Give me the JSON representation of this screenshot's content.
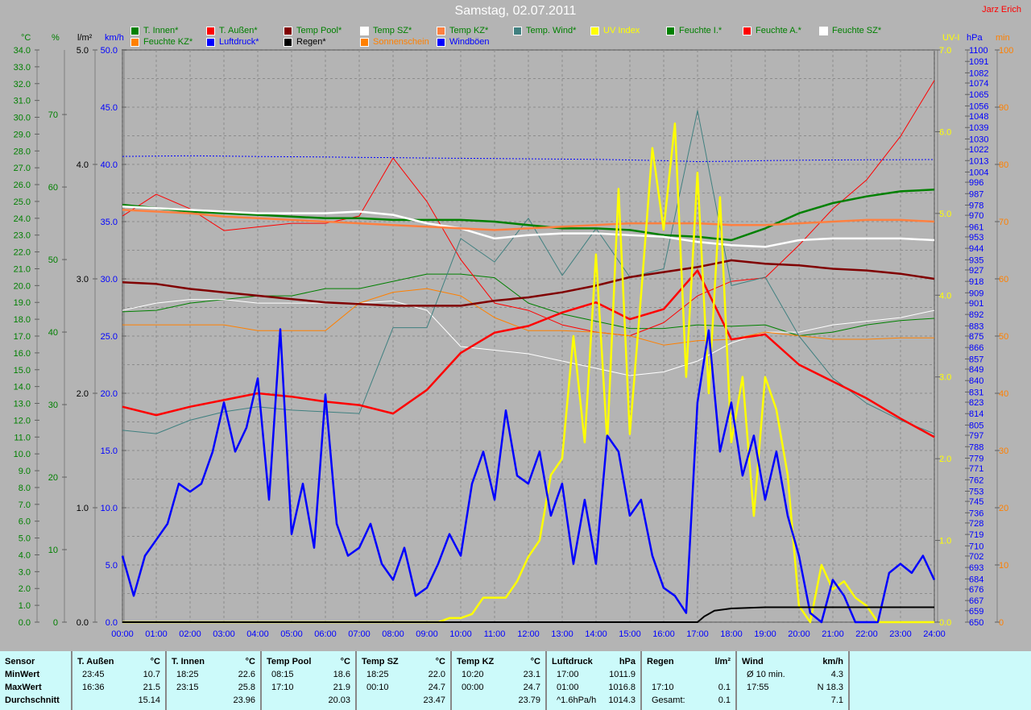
{
  "header": {
    "title": "Samstag, 02.07.2011",
    "author": "Jarz Erich"
  },
  "legend": [
    {
      "label": "T. Innen*",
      "color": "#008000",
      "text": "#008000"
    },
    {
      "label": "T. Außen*",
      "color": "#ff0000",
      "text": "#008000"
    },
    {
      "label": "Temp Pool*",
      "color": "#800000",
      "text": "#008000"
    },
    {
      "label": "Temp SZ*",
      "color": "#ffffff",
      "text": "#008000"
    },
    {
      "label": "Temp KZ*",
      "color": "#ff8040",
      "text": "#008000"
    },
    {
      "label": "Temp. Wind*",
      "color": "#408080",
      "text": "#008000"
    },
    {
      "label": "UV Index",
      "color": "#ffff00",
      "text": "#ffff00"
    },
    {
      "label": "Feuchte I.*",
      "color": "#008000",
      "text": "#008000"
    },
    {
      "label": "Feuchte A.*",
      "color": "#ff0000",
      "text": "#008000"
    },
    {
      "label": "Feuchte SZ*",
      "color": "#ffffff",
      "text": "#008000"
    },
    {
      "label": "Feuchte KZ*",
      "color": "#ff8000",
      "text": "#008000"
    },
    {
      "label": "Luftdruck*",
      "color": "#0000ff",
      "text": "#0000ff"
    },
    {
      "label": "Regen*",
      "color": "#000000",
      "text": "#000000"
    },
    {
      "label": "Sonnenschein",
      "color": "#ff8000",
      "text": "#ff8000"
    },
    {
      "label": "Windböen",
      "color": "#0000ff",
      "text": "#0000ff"
    }
  ],
  "chart_data": {
    "type": "line",
    "title": "Samstag, 02.07.2011",
    "xlabel": "",
    "x_ticks": [
      "00:00",
      "01:00",
      "02:00",
      "03:00",
      "04:00",
      "05:00",
      "06:00",
      "07:00",
      "08:00",
      "09:00",
      "10:00",
      "11:00",
      "12:00",
      "13:00",
      "14:00",
      "15:00",
      "16:00",
      "17:00",
      "18:00",
      "19:00",
      "20:00",
      "21:00",
      "22:00",
      "23:00",
      "24:00"
    ],
    "xlim": [
      0,
      24
    ],
    "grid": true,
    "axes": {
      "degC": {
        "unit": "°C",
        "color": "#008000",
        "range": [
          0,
          34
        ],
        "ticks": [
          "0.0",
          "1.0",
          "2.0",
          "3.0",
          "4.0",
          "5.0",
          "6.0",
          "7.0",
          "8.0",
          "9.0",
          "10.0",
          "11.0",
          "12.0",
          "13.0",
          "14.0",
          "15.0",
          "16.0",
          "17.0",
          "18.0",
          "19.0",
          "20.0",
          "21.0",
          "22.0",
          "23.0",
          "24.0",
          "25.0",
          "26.0",
          "27.0",
          "28.0",
          "29.0",
          "30.0",
          "31.0",
          "32.0",
          "33.0",
          "34.0"
        ]
      },
      "pct": {
        "unit": "%",
        "color": "#008000",
        "range": [
          0,
          78.9
        ],
        "ticks": [
          "0",
          "10",
          "20",
          "30",
          "40",
          "50",
          "60",
          "70"
        ]
      },
      "rain": {
        "unit": "l/m²",
        "color": "#000000",
        "range": [
          0,
          5
        ],
        "ticks": [
          "0.0",
          "1.0",
          "2.0",
          "3.0",
          "4.0",
          "5.0"
        ]
      },
      "kmh": {
        "unit": "km/h",
        "color": "#0000ff",
        "range": [
          0,
          50
        ],
        "ticks": [
          "0.0",
          "5.0",
          "10.0",
          "15.0",
          "20.0",
          "25.0",
          "30.0",
          "35.0",
          "40.0",
          "45.0",
          "50.0"
        ]
      },
      "uv": {
        "unit": "UV-I",
        "color": "#ffff00",
        "range": [
          0,
          7
        ],
        "ticks": [
          "0.0",
          "1.0",
          "2.0",
          "3.0",
          "4.0",
          "5.0",
          "6.0",
          "7.0"
        ]
      },
      "hpa": {
        "unit": "hPa",
        "color": "#0000ff",
        "range": [
          650,
          1100
        ],
        "ticks": [
          "650",
          "659",
          "667",
          "676",
          "684",
          "693",
          "702",
          "710",
          "719",
          "728",
          "736",
          "745",
          "753",
          "762",
          "771",
          "779",
          "788",
          "797",
          "805",
          "814",
          "823",
          "831",
          "840",
          "849",
          "857",
          "866",
          "875",
          "883",
          "892",
          "901",
          "909",
          "918",
          "927",
          "935",
          "944",
          "953",
          "961",
          "970",
          "978",
          "987",
          "996",
          "1004",
          "1013",
          "1022",
          "1030",
          "1039",
          "1048",
          "1056",
          "1065",
          "1074",
          "1082",
          "1091",
          "1100"
        ]
      },
      "min": {
        "unit": "min",
        "color": "#ff8000",
        "range": [
          0,
          100
        ],
        "ticks": [
          "0",
          "10",
          "20",
          "30",
          "40",
          "50",
          "60",
          "70",
          "80",
          "90",
          "100"
        ]
      }
    },
    "series": [
      {
        "name": "Feuchte I.*",
        "axis": "pct",
        "color": "#008000",
        "width": 1,
        "step": 1,
        "values": [
          42.8,
          43,
          44,
          44.5,
          45,
          45,
          46,
          46,
          47,
          48,
          48,
          47.5,
          44,
          42.5,
          41.5,
          40.5,
          40.5,
          41,
          40.8,
          41,
          39.5,
          40,
          41,
          41.6,
          41.9
        ]
      },
      {
        "name": "Feuchte A.*",
        "axis": "pct",
        "color": "#ff0000",
        "width": 1,
        "step": 1,
        "values": [
          56,
          59,
          57,
          54,
          54.5,
          55,
          55,
          56,
          64,
          58,
          50,
          44,
          43,
          41,
          40,
          39.5,
          41.3,
          45,
          47,
          47.5,
          52,
          57,
          61,
          67,
          74.7
        ]
      },
      {
        "name": "Feuchte SZ*",
        "axis": "pct",
        "color": "#ffffff",
        "width": 1,
        "step": 1,
        "values": [
          43,
          44,
          44.5,
          44.5,
          44,
          44,
          44,
          44,
          44.3,
          43,
          38,
          37.5,
          37,
          36,
          35,
          34,
          34.5,
          36,
          38.5,
          40,
          40,
          41,
          41.5,
          42,
          43
        ]
      },
      {
        "name": "Feuchte KZ*",
        "axis": "pct",
        "color": "#ff8000",
        "width": 1,
        "step": 1,
        "values": [
          41,
          41,
          41,
          41,
          40.2,
          40.2,
          40.2,
          44,
          45.5,
          46,
          45,
          42,
          40.2,
          40.2,
          40,
          39.5,
          38.2,
          38.8,
          39,
          40,
          39.5,
          39,
          39,
          39.2,
          39.2
        ]
      },
      {
        "name": "Temp. Wind*",
        "axis": "degC",
        "color": "#408080",
        "width": 1,
        "step": 1,
        "values": [
          11.4,
          11.2,
          12,
          12.5,
          12.8,
          12.6,
          12.5,
          12.4,
          17.5,
          17.5,
          22.8,
          21.4,
          24,
          20.6,
          23.4,
          20.5,
          21,
          30.4,
          20,
          20.5,
          17,
          14.5,
          13,
          12,
          11.2
        ]
      },
      {
        "name": "Luftdruck*",
        "axis": "hpa",
        "color": "#0000ff",
        "width": 1,
        "dash": true,
        "step": 1,
        "values": [
          1016.3,
          1016.5,
          1016.8,
          1016.5,
          1016.2,
          1016,
          1015.8,
          1015.5,
          1015.3,
          1015,
          1014.8,
          1014.6,
          1014.4,
          1014.2,
          1013.9,
          1013.5,
          1013,
          1012.2,
          1012.5,
          1013,
          1013.3,
          1013.5,
          1013.6,
          1013.7,
          1013.8
        ]
      },
      {
        "name": "T. Innen*",
        "axis": "degC",
        "color": "#008000",
        "width": 2.5,
        "step": 1,
        "values": [
          24.8,
          24.6,
          24.4,
          24.3,
          24.2,
          24.1,
          24,
          24,
          23.9,
          23.9,
          23.9,
          23.8,
          23.6,
          23.4,
          23.4,
          23.3,
          23,
          22.9,
          22.7,
          23.4,
          24.3,
          24.9,
          25.3,
          25.6,
          25.7
        ]
      },
      {
        "name": "Temp Pool*",
        "axis": "degC",
        "color": "#800000",
        "width": 2.5,
        "step": 1,
        "values": [
          20.2,
          20.1,
          19.8,
          19.6,
          19.4,
          19.2,
          19,
          18.9,
          18.8,
          18.8,
          18.8,
          19.1,
          19.3,
          19.6,
          20,
          20.5,
          20.8,
          21.1,
          21.5,
          21.3,
          21.2,
          21,
          20.9,
          20.7,
          20.4
        ]
      },
      {
        "name": "Temp SZ*",
        "axis": "degC",
        "color": "#ffffff",
        "width": 2.5,
        "step": 1,
        "values": [
          24.7,
          24.6,
          24.5,
          24.4,
          24.3,
          24.3,
          24.3,
          24.4,
          24.2,
          23.7,
          23.4,
          22.8,
          23,
          23.1,
          23.1,
          23,
          22.9,
          22.6,
          22.4,
          22.3,
          22.7,
          22.8,
          22.8,
          22.8,
          22.7
        ]
      },
      {
        "name": "Temp KZ*",
        "axis": "degC",
        "color": "#ff8040",
        "width": 2.5,
        "step": 1,
        "values": [
          24.5,
          24.4,
          24.3,
          24.1,
          24,
          23.9,
          23.8,
          23.7,
          23.6,
          23.5,
          23.4,
          23.3,
          23.4,
          23.5,
          23.6,
          23.7,
          23.7,
          23.7,
          23.6,
          23.6,
          23.7,
          23.8,
          23.9,
          23.9,
          23.8
        ]
      },
      {
        "name": "T. Außen*",
        "axis": "degC",
        "color": "#ff0000",
        "width": 2.5,
        "step": 1,
        "values": [
          12.8,
          12.3,
          12.8,
          13.2,
          13.6,
          13.4,
          13.1,
          12.9,
          12.4,
          13.8,
          16,
          17.2,
          17.6,
          18.4,
          19,
          18,
          18.6,
          20.9,
          16.8,
          17.1,
          15.3,
          14.3,
          13.3,
          12.1,
          11
        ]
      },
      {
        "name": "UV Index",
        "axis": "uv",
        "color": "#ffff00",
        "width": 2.5,
        "step": 0.3333,
        "values": [
          0,
          0,
          0,
          0,
          0,
          0,
          0,
          0,
          0,
          0,
          0,
          0,
          0,
          0,
          0,
          0,
          0,
          0,
          0,
          0,
          0,
          0,
          0,
          0,
          0,
          0,
          0,
          0,
          0,
          0.05,
          0.05,
          0.1,
          0.3,
          0.3,
          0.3,
          0.5,
          0.8,
          1.0,
          1.8,
          2.0,
          3.5,
          2.2,
          4.5,
          2.2,
          5.3,
          2.3,
          4.0,
          5.8,
          4.8,
          6.1,
          3.0,
          5.5,
          2.8,
          5.2,
          2.2,
          3.0,
          1.3,
          3.0,
          2.6,
          1.8,
          0.2,
          0,
          0.7,
          0.4,
          0.5,
          0.3,
          0.2,
          0,
          0,
          0,
          0,
          0,
          0
        ]
      },
      {
        "name": "Windböen",
        "axis": "kmh",
        "color": "#0000ff",
        "width": 2.5,
        "step": 0.3333,
        "values": [
          5.8,
          2.3,
          5.8,
          7.2,
          8.6,
          12.1,
          11.4,
          12.1,
          14.9,
          19.2,
          14.9,
          17,
          21.3,
          10.7,
          25.6,
          7.7,
          12.1,
          6.5,
          19.9,
          8.6,
          5.8,
          6.5,
          8.6,
          5.1,
          3.7,
          6.5,
          2.3,
          3,
          5.1,
          7.7,
          5.8,
          12.1,
          14.9,
          10.7,
          18.5,
          12.8,
          12.1,
          14.9,
          9.3,
          12.1,
          5.1,
          10.7,
          5.1,
          16.3,
          14.9,
          9.3,
          10.7,
          5.8,
          3,
          2.3,
          0.8,
          19.2,
          25.5,
          14.9,
          19.2,
          12.8,
          16.3,
          10.7,
          14.9,
          9.3,
          5.8,
          0.8,
          0,
          3.7,
          2.3,
          0,
          0,
          0,
          4.3,
          5.1,
          4.3,
          5.8,
          3.7
        ]
      },
      {
        "name": "Regen*",
        "axis": "rain",
        "color": "#000000",
        "width": 2,
        "points": [
          [
            0,
            0
          ],
          [
            17.0,
            0
          ],
          [
            17.2,
            0.05
          ],
          [
            17.5,
            0.1
          ],
          [
            18,
            0.12
          ],
          [
            19,
            0.13
          ],
          [
            24,
            0.13
          ]
        ]
      }
    ]
  },
  "table": {
    "columns": [
      {
        "title": "Sensor",
        "unit": "",
        "rows": [
          [
            "MinWert",
            ""
          ],
          [
            "MaxWert",
            ""
          ],
          [
            "Durchschnitt",
            ""
          ]
        ],
        "bold": true
      },
      {
        "title": "T. Außen",
        "unit": "°C",
        "rows": [
          [
            "23:45",
            "10.7"
          ],
          [
            "16:36",
            "21.5"
          ],
          [
            "",
            "15.14"
          ]
        ]
      },
      {
        "title": "T. Innen",
        "unit": "°C",
        "rows": [
          [
            "18:25",
            "22.6"
          ],
          [
            "23:15",
            "25.8"
          ],
          [
            "",
            "23.96"
          ]
        ]
      },
      {
        "title": "Temp Pool",
        "unit": "°C",
        "rows": [
          [
            "08:15",
            "18.6"
          ],
          [
            "17:10",
            "21.9"
          ],
          [
            "",
            "20.03"
          ]
        ]
      },
      {
        "title": "Temp SZ",
        "unit": "°C",
        "rows": [
          [
            "18:25",
            "22.0"
          ],
          [
            "00:10",
            "24.7"
          ],
          [
            "",
            "23.47"
          ]
        ]
      },
      {
        "title": "Temp KZ",
        "unit": "°C",
        "rows": [
          [
            "10:20",
            "23.1"
          ],
          [
            "00:00",
            "24.7"
          ],
          [
            "",
            "23.79"
          ]
        ]
      },
      {
        "title": "Luftdruck",
        "unit": "hPa",
        "rows": [
          [
            "17:00",
            "1011.9"
          ],
          [
            "01:00",
            "1016.8"
          ],
          [
            "^1.6hPa/h",
            "1014.3"
          ]
        ]
      },
      {
        "title": "Regen",
        "unit": "l/m²",
        "rows": [
          [
            "",
            ""
          ],
          [
            "17:10",
            "0.1"
          ],
          [
            "Gesamt:",
            "0.1"
          ]
        ]
      },
      {
        "title": "Wind",
        "unit": "km/h",
        "rows": [
          [
            "Ø 10 min.",
            "4.3"
          ],
          [
            "17:55",
            "N 18.3"
          ],
          [
            "",
            "7.1"
          ]
        ]
      }
    ]
  }
}
